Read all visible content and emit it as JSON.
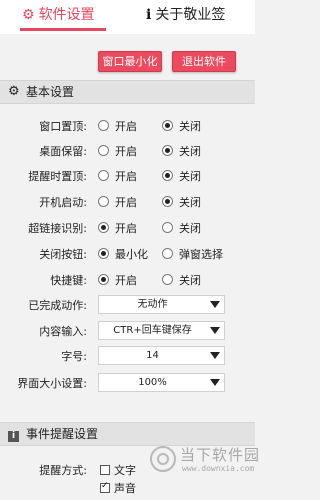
{
  "tabs": {
    "settings_label": "软件设置",
    "about_label": "关于敬业签"
  },
  "actions": {
    "minimize_label": "窗口最小化",
    "exit_label": "退出软件"
  },
  "basic": {
    "title": "基本设置",
    "on_label": "开启",
    "off_label": "关闭",
    "rows": [
      {
        "label": "窗口置顶:",
        "selected": "off"
      },
      {
        "label": "桌面保留:",
        "selected": "off"
      },
      {
        "label": "提醒时置顶:",
        "selected": "off"
      },
      {
        "label": "开机启动:",
        "selected": "off"
      },
      {
        "label": "超链接识别:",
        "selected": "on"
      }
    ],
    "close_button": {
      "label": "关闭按钮:",
      "opt1": "最小化",
      "opt2": "弹窗选择",
      "selected": "opt1"
    },
    "hotkey": {
      "label": "快捷键:",
      "opt1": "开启",
      "opt2": "关闭",
      "selected": "opt1"
    },
    "selects": {
      "completed": {
        "label": "已完成动作:",
        "value": "无动作"
      },
      "input": {
        "label": "内容输入:",
        "value": "CTR+回车键保存"
      },
      "font_size": {
        "label": "字号:",
        "value": "14"
      },
      "ui_size": {
        "label": "界面大小设置:",
        "value": "100%"
      }
    }
  },
  "events": {
    "title": "事件提醒设置",
    "remind_label": "提醒方式:",
    "text_option": "文字",
    "sound_option": "声音",
    "text_checked": false,
    "sound_checked": true
  },
  "watermark": {
    "cn": "当下软件园",
    "url": "www.downxia.com"
  },
  "colors": {
    "accent": "#e8475e",
    "section_bg": "#e2e2e2",
    "page_bg": "#f2f2f2"
  },
  "icons": {
    "settings_tab": "gear-icon",
    "about_tab": "info-icon",
    "basic_section": "gear-icon",
    "events_section": "info-icon",
    "watermark": "logo-icon"
  }
}
